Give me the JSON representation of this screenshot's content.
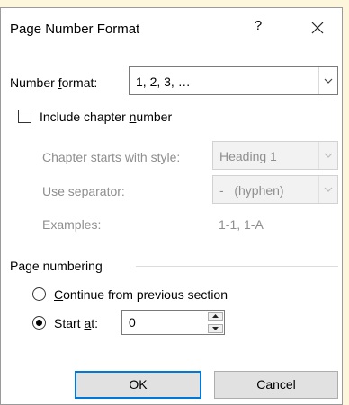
{
  "dialog": {
    "title": "Page Number Format",
    "help_label": "?",
    "close_label": "close"
  },
  "number_format": {
    "label_pre": "Number ",
    "label_key": "f",
    "label_post": "ormat:",
    "value": "1, 2, 3, …"
  },
  "include_chapter": {
    "label_pre": "Include chapter ",
    "label_key": "n",
    "label_post": "umber",
    "checked": false
  },
  "chapter_style": {
    "label": "Chapter starts with style:",
    "value": "Heading 1"
  },
  "separator": {
    "label": "Use separator:",
    "value": "-   (hyphen)"
  },
  "examples": {
    "label": "Examples:",
    "value": "1-1, 1-A"
  },
  "page_numbering": {
    "group_label": "Page numbering",
    "continue_pre": "",
    "continue_key": "C",
    "continue_post": "ontinue from previous section",
    "start_pre": "Start ",
    "start_key": "a",
    "start_post": "t:",
    "start_value": "0",
    "selected": "start"
  },
  "buttons": {
    "ok": "OK",
    "cancel": "Cancel"
  }
}
